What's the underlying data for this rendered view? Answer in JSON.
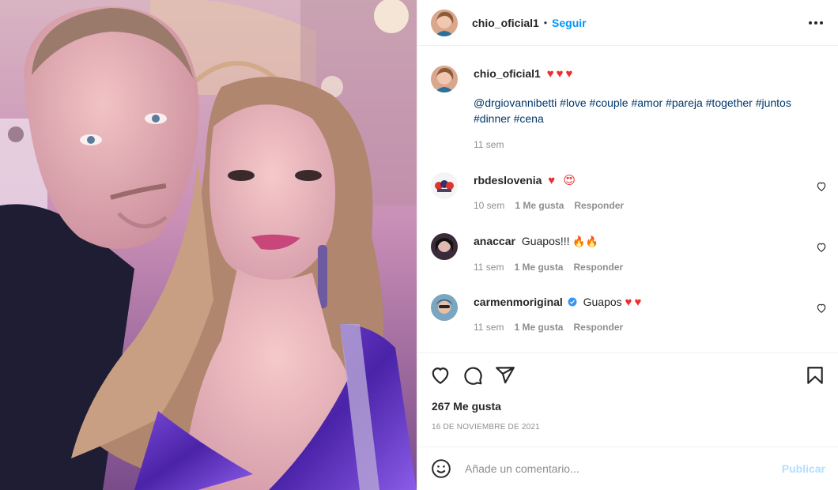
{
  "post": {
    "author": "chio_oficial1",
    "separator": "•",
    "follow_label": "Seguir",
    "more_icon": "more-horizontal-icon",
    "caption": {
      "user": "chio_oficial1",
      "hearts": "♥♥♥",
      "text_lines": [
        [
          "@drgiovannibetti",
          "#love",
          "#couple",
          "#amor",
          "#pareja",
          "#together",
          "#juntos"
        ],
        [
          "#dinner",
          "#cena"
        ]
      ],
      "time": "11 sem"
    },
    "comments": [
      {
        "user": "rbdeslovenia",
        "verified": false,
        "text": "",
        "emoji": "♥ 😍",
        "time": "10 sem",
        "likes": "1 Me gusta",
        "reply": "Responder"
      },
      {
        "user": "anaccar",
        "verified": false,
        "text": "Guapos!!!",
        "emoji": "🔥🔥",
        "time": "11 sem",
        "likes": "1 Me gusta",
        "reply": "Responder"
      },
      {
        "user": "carmenmoriginal",
        "verified": true,
        "text": "Guapos",
        "emoji": "♥♥",
        "time": "11 sem",
        "likes": "1 Me gusta",
        "reply": "Responder"
      }
    ],
    "likes_label": "267 Me gusta",
    "date": "16 de noviembre de 2021",
    "comment_input": {
      "placeholder": "Añade un comentario...",
      "value": ""
    },
    "publish_label": "Publicar"
  },
  "colors": {
    "link_blue": "#0095f6",
    "hashtag": "#00376b",
    "secondary_text": "#8e8e8e",
    "heart_red": "#ed2e2e",
    "publish_disabled": "#b2dffc"
  },
  "icons": [
    "heart-icon",
    "comment-icon",
    "share-icon",
    "bookmark-icon",
    "emoji-icon",
    "verified-icon"
  ]
}
